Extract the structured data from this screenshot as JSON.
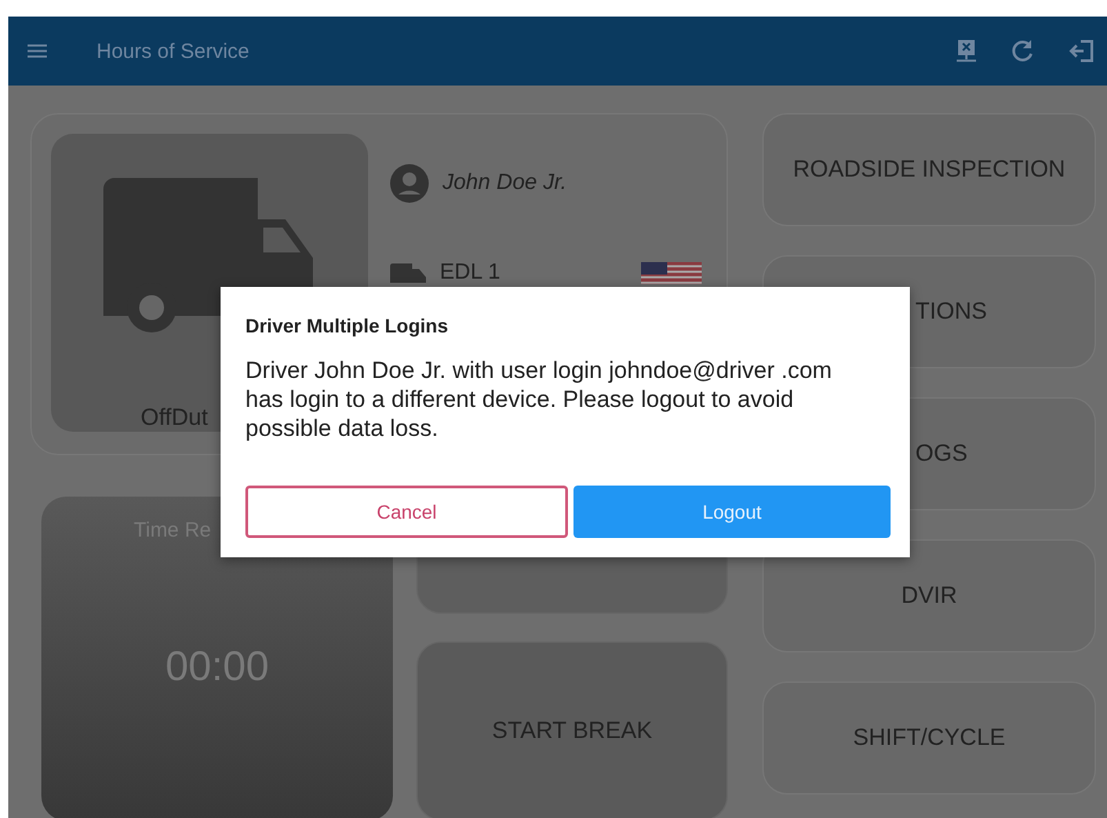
{
  "app_bar": {
    "title": "Hours of Service"
  },
  "status_card": {
    "duty_status": "OffDut",
    "driver_name": "John Doe Jr.",
    "vehicle": "EDL 1"
  },
  "time_panel": {
    "label": "Time Re",
    "time": "00:00"
  },
  "action_buttons": [
    {
      "label": "START BREAK"
    }
  ],
  "menu_buttons": [
    {
      "label": "ROADSIDE INSPECTION",
      "kind": "full"
    },
    {
      "label": "TIONS",
      "kind": "partial"
    },
    {
      "label": "OGS",
      "kind": "partial"
    },
    {
      "label": "DVIR",
      "kind": "full"
    },
    {
      "label": "SHIFT/CYCLE",
      "kind": "full"
    }
  ],
  "dialog": {
    "title": "Driver Multiple Logins",
    "message": "Driver John Doe Jr. with user login johndoe@driver .com has login to a different device. Please logout to avoid possible data loss.",
    "buttons": [
      {
        "label": "Cancel",
        "kind": "outline"
      },
      {
        "label": "Logout",
        "kind": "primary"
      }
    ]
  }
}
